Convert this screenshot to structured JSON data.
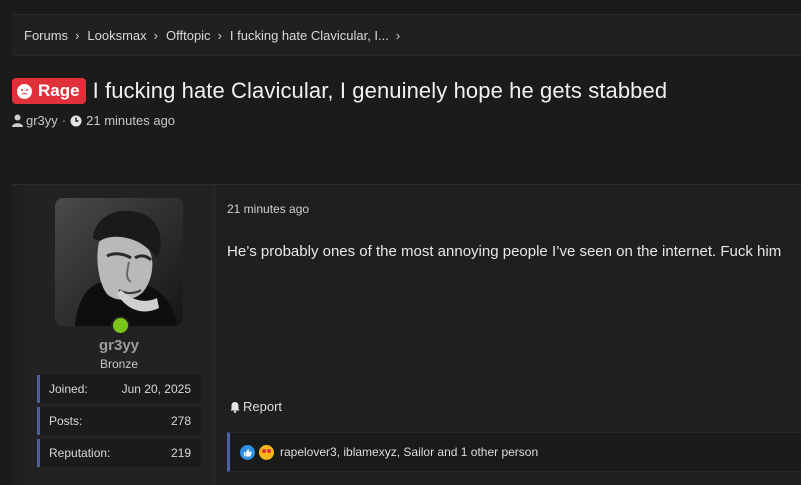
{
  "breadcrumb": {
    "items": [
      {
        "label": "Forums"
      },
      {
        "label": "Looksmax"
      },
      {
        "label": "Offtopic"
      },
      {
        "label": "I fucking hate Clavicular, I..."
      }
    ],
    "separator": "›"
  },
  "thread": {
    "prefix_label": "Rage",
    "prefix_color": "#e0313a",
    "title": "I fucking hate Clavicular, I genuinely hope he gets stabbed",
    "author": "gr3yy",
    "meta_separator": "·",
    "time": "21 minutes ago"
  },
  "post": {
    "user": {
      "name": "gr3yy",
      "rank": "Bronze",
      "online": true,
      "stats": [
        {
          "label": "Joined:",
          "value": "Jun 20, 2025"
        },
        {
          "label": "Posts:",
          "value": "278"
        },
        {
          "label": "Reputation:",
          "value": "219"
        }
      ]
    },
    "time": "21 minutes ago",
    "body": "He’s probably ones of the most annoying people I’ve seen on the internet. Fuck him",
    "report_label": "Report",
    "reactions_text": "rapelover3, iblamexyz, Sailor and 1 other person",
    "reaction_icons": [
      "like-icon",
      "love-eyes-icon"
    ]
  },
  "colors": {
    "accent": "#4d5fa6",
    "online": "#7bc51b"
  }
}
